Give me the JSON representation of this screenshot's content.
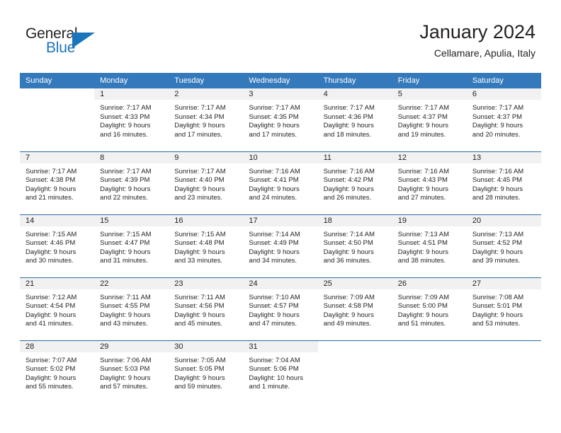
{
  "brand": {
    "name_part1": "General",
    "name_part2": "Blue",
    "logo_icon": "triangle-flag-icon",
    "accent_color": "#1b75bb"
  },
  "header": {
    "title": "January 2024",
    "subtitle": "Cellamare, Apulia, Italy"
  },
  "theme": {
    "header_band_color": "#3479bb",
    "row_divider_color": "#2e6da4",
    "daynum_strip_color": "#f1f1f1",
    "text_color": "#231f20"
  },
  "weekdays": [
    "Sunday",
    "Monday",
    "Tuesday",
    "Wednesday",
    "Thursday",
    "Friday",
    "Saturday"
  ],
  "weeks": [
    [
      {
        "day": "",
        "sunrise": "",
        "sunset": "",
        "daylight_line1": "",
        "daylight_line2": "",
        "blank": true
      },
      {
        "day": "1",
        "sunrise": "Sunrise: 7:17 AM",
        "sunset": "Sunset: 4:33 PM",
        "daylight_line1": "Daylight: 9 hours",
        "daylight_line2": "and 16 minutes."
      },
      {
        "day": "2",
        "sunrise": "Sunrise: 7:17 AM",
        "sunset": "Sunset: 4:34 PM",
        "daylight_line1": "Daylight: 9 hours",
        "daylight_line2": "and 17 minutes."
      },
      {
        "day": "3",
        "sunrise": "Sunrise: 7:17 AM",
        "sunset": "Sunset: 4:35 PM",
        "daylight_line1": "Daylight: 9 hours",
        "daylight_line2": "and 17 minutes."
      },
      {
        "day": "4",
        "sunrise": "Sunrise: 7:17 AM",
        "sunset": "Sunset: 4:36 PM",
        "daylight_line1": "Daylight: 9 hours",
        "daylight_line2": "and 18 minutes."
      },
      {
        "day": "5",
        "sunrise": "Sunrise: 7:17 AM",
        "sunset": "Sunset: 4:37 PM",
        "daylight_line1": "Daylight: 9 hours",
        "daylight_line2": "and 19 minutes."
      },
      {
        "day": "6",
        "sunrise": "Sunrise: 7:17 AM",
        "sunset": "Sunset: 4:37 PM",
        "daylight_line1": "Daylight: 9 hours",
        "daylight_line2": "and 20 minutes."
      }
    ],
    [
      {
        "day": "7",
        "sunrise": "Sunrise: 7:17 AM",
        "sunset": "Sunset: 4:38 PM",
        "daylight_line1": "Daylight: 9 hours",
        "daylight_line2": "and 21 minutes."
      },
      {
        "day": "8",
        "sunrise": "Sunrise: 7:17 AM",
        "sunset": "Sunset: 4:39 PM",
        "daylight_line1": "Daylight: 9 hours",
        "daylight_line2": "and 22 minutes."
      },
      {
        "day": "9",
        "sunrise": "Sunrise: 7:17 AM",
        "sunset": "Sunset: 4:40 PM",
        "daylight_line1": "Daylight: 9 hours",
        "daylight_line2": "and 23 minutes."
      },
      {
        "day": "10",
        "sunrise": "Sunrise: 7:16 AM",
        "sunset": "Sunset: 4:41 PM",
        "daylight_line1": "Daylight: 9 hours",
        "daylight_line2": "and 24 minutes."
      },
      {
        "day": "11",
        "sunrise": "Sunrise: 7:16 AM",
        "sunset": "Sunset: 4:42 PM",
        "daylight_line1": "Daylight: 9 hours",
        "daylight_line2": "and 26 minutes."
      },
      {
        "day": "12",
        "sunrise": "Sunrise: 7:16 AM",
        "sunset": "Sunset: 4:43 PM",
        "daylight_line1": "Daylight: 9 hours",
        "daylight_line2": "and 27 minutes."
      },
      {
        "day": "13",
        "sunrise": "Sunrise: 7:16 AM",
        "sunset": "Sunset: 4:45 PM",
        "daylight_line1": "Daylight: 9 hours",
        "daylight_line2": "and 28 minutes."
      }
    ],
    [
      {
        "day": "14",
        "sunrise": "Sunrise: 7:15 AM",
        "sunset": "Sunset: 4:46 PM",
        "daylight_line1": "Daylight: 9 hours",
        "daylight_line2": "and 30 minutes."
      },
      {
        "day": "15",
        "sunrise": "Sunrise: 7:15 AM",
        "sunset": "Sunset: 4:47 PM",
        "daylight_line1": "Daylight: 9 hours",
        "daylight_line2": "and 31 minutes."
      },
      {
        "day": "16",
        "sunrise": "Sunrise: 7:15 AM",
        "sunset": "Sunset: 4:48 PM",
        "daylight_line1": "Daylight: 9 hours",
        "daylight_line2": "and 33 minutes."
      },
      {
        "day": "17",
        "sunrise": "Sunrise: 7:14 AM",
        "sunset": "Sunset: 4:49 PM",
        "daylight_line1": "Daylight: 9 hours",
        "daylight_line2": "and 34 minutes."
      },
      {
        "day": "18",
        "sunrise": "Sunrise: 7:14 AM",
        "sunset": "Sunset: 4:50 PM",
        "daylight_line1": "Daylight: 9 hours",
        "daylight_line2": "and 36 minutes."
      },
      {
        "day": "19",
        "sunrise": "Sunrise: 7:13 AM",
        "sunset": "Sunset: 4:51 PM",
        "daylight_line1": "Daylight: 9 hours",
        "daylight_line2": "and 38 minutes."
      },
      {
        "day": "20",
        "sunrise": "Sunrise: 7:13 AM",
        "sunset": "Sunset: 4:52 PM",
        "daylight_line1": "Daylight: 9 hours",
        "daylight_line2": "and 39 minutes."
      }
    ],
    [
      {
        "day": "21",
        "sunrise": "Sunrise: 7:12 AM",
        "sunset": "Sunset: 4:54 PM",
        "daylight_line1": "Daylight: 9 hours",
        "daylight_line2": "and 41 minutes."
      },
      {
        "day": "22",
        "sunrise": "Sunrise: 7:11 AM",
        "sunset": "Sunset: 4:55 PM",
        "daylight_line1": "Daylight: 9 hours",
        "daylight_line2": "and 43 minutes."
      },
      {
        "day": "23",
        "sunrise": "Sunrise: 7:11 AM",
        "sunset": "Sunset: 4:56 PM",
        "daylight_line1": "Daylight: 9 hours",
        "daylight_line2": "and 45 minutes."
      },
      {
        "day": "24",
        "sunrise": "Sunrise: 7:10 AM",
        "sunset": "Sunset: 4:57 PM",
        "daylight_line1": "Daylight: 9 hours",
        "daylight_line2": "and 47 minutes."
      },
      {
        "day": "25",
        "sunrise": "Sunrise: 7:09 AM",
        "sunset": "Sunset: 4:58 PM",
        "daylight_line1": "Daylight: 9 hours",
        "daylight_line2": "and 49 minutes."
      },
      {
        "day": "26",
        "sunrise": "Sunrise: 7:09 AM",
        "sunset": "Sunset: 5:00 PM",
        "daylight_line1": "Daylight: 9 hours",
        "daylight_line2": "and 51 minutes."
      },
      {
        "day": "27",
        "sunrise": "Sunrise: 7:08 AM",
        "sunset": "Sunset: 5:01 PM",
        "daylight_line1": "Daylight: 9 hours",
        "daylight_line2": "and 53 minutes."
      }
    ],
    [
      {
        "day": "28",
        "sunrise": "Sunrise: 7:07 AM",
        "sunset": "Sunset: 5:02 PM",
        "daylight_line1": "Daylight: 9 hours",
        "daylight_line2": "and 55 minutes."
      },
      {
        "day": "29",
        "sunrise": "Sunrise: 7:06 AM",
        "sunset": "Sunset: 5:03 PM",
        "daylight_line1": "Daylight: 9 hours",
        "daylight_line2": "and 57 minutes."
      },
      {
        "day": "30",
        "sunrise": "Sunrise: 7:05 AM",
        "sunset": "Sunset: 5:05 PM",
        "daylight_line1": "Daylight: 9 hours",
        "daylight_line2": "and 59 minutes."
      },
      {
        "day": "31",
        "sunrise": "Sunrise: 7:04 AM",
        "sunset": "Sunset: 5:06 PM",
        "daylight_line1": "Daylight: 10 hours",
        "daylight_line2": "and 1 minute."
      },
      {
        "day": "",
        "sunrise": "",
        "sunset": "",
        "daylight_line1": "",
        "daylight_line2": "",
        "blank": true
      },
      {
        "day": "",
        "sunrise": "",
        "sunset": "",
        "daylight_line1": "",
        "daylight_line2": "",
        "blank": true
      },
      {
        "day": "",
        "sunrise": "",
        "sunset": "",
        "daylight_line1": "",
        "daylight_line2": "",
        "blank": true
      }
    ]
  ]
}
